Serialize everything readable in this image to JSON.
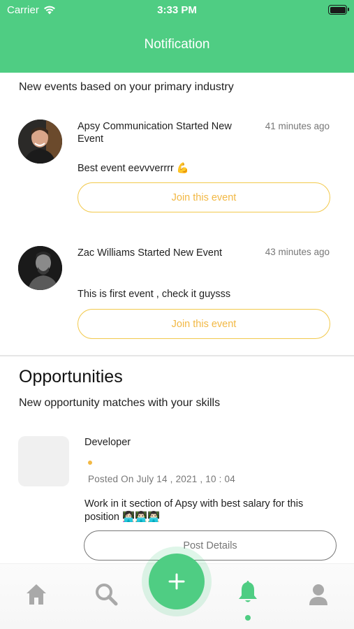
{
  "status_bar": {
    "carrier": "Carrier",
    "time": "3:33 PM"
  },
  "header": {
    "title": "Notification"
  },
  "events_section": {
    "subtitle": "New events based on your primary industry",
    "items": [
      {
        "title": "Apsy Communication Started New Event",
        "time": "41 minutes ago",
        "description": "Best event eevvverrrr 💪",
        "button": "Join this event"
      },
      {
        "title": "Zac Williams Started New Event",
        "time": "43 minutes ago",
        "description": "This is first event , check it guysss",
        "button": "Join this event"
      }
    ]
  },
  "opportunities": {
    "heading": "Opportunities",
    "subtitle": "New opportunity matches with your skills",
    "items": [
      {
        "title": "Developer",
        "date": "Posted On July  14 , 2021  , 10 : 04",
        "description": "Work in it section of Apsy with best salary for this position 👩🏻‍💻👨🏻‍💻👨🏻‍💻",
        "button": "Post Details"
      }
    ]
  },
  "tab_bar": {
    "active": "notifications",
    "icons": [
      "home-icon",
      "search-icon",
      "plus-icon",
      "bell-icon",
      "profile-icon"
    ]
  },
  "colors": {
    "brand_green": "#4fcd83",
    "accent_yellow": "#f2b844",
    "inactive_icon": "#a9a9a9"
  }
}
